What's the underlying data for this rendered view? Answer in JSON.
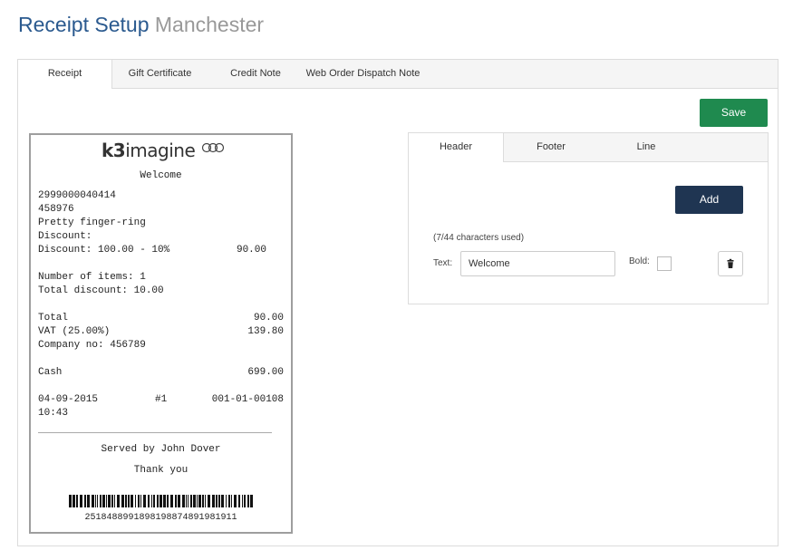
{
  "header": {
    "title": "Receipt Setup",
    "location": "Manchester"
  },
  "tabs": [
    {
      "label": "Receipt",
      "active": true
    },
    {
      "label": "Gift Certificate",
      "active": false
    },
    {
      "label": "Credit Note",
      "active": false
    },
    {
      "label": "Web Order Dispatch Note",
      "active": false
    }
  ],
  "toolbar": {
    "save_label": "Save"
  },
  "receipt": {
    "logo": {
      "brand_prefix": "k3",
      "brand_name": "imagine"
    },
    "welcome": "Welcome",
    "item_barcode": "2999000040414",
    "item_code": "458976",
    "item_name": "Pretty finger-ring",
    "discount_label": "Discount:",
    "discount_detail": "Discount: 100.00 - 10%",
    "discount_amount": "90.00",
    "items_count": "Number of items: 1",
    "total_discount": "Total discount: 10.00",
    "total_label": "Total",
    "total_value": "90.00",
    "vat_label": "VAT (25.00%)",
    "vat_value": "139.80",
    "company_no": "Company no: 456789",
    "cash_label": "Cash",
    "cash_value": "699.00",
    "date": "04-09-2015",
    "till": "#1",
    "transaction": "001-01-00108",
    "time": "10:43",
    "served_by": "Served by John Dover",
    "thank_you": "Thank you",
    "barcode_number": "2518488991898198874891981911"
  },
  "editor": {
    "tabs": [
      {
        "label": "Header",
        "active": true
      },
      {
        "label": "Footer",
        "active": false
      },
      {
        "label": "Line",
        "active": false
      }
    ],
    "add_label": "Add",
    "chars_used": "(7/44 characters used)",
    "text_label": "Text:",
    "text_value": "Welcome",
    "bold_label": "Bold:",
    "bold_checked": false,
    "delete_icon": "trash-icon"
  },
  "colors": {
    "title": "#2b5a8f",
    "subtitle": "#999999",
    "save_button": "#1f8a4f",
    "add_button": "#1f3552"
  }
}
